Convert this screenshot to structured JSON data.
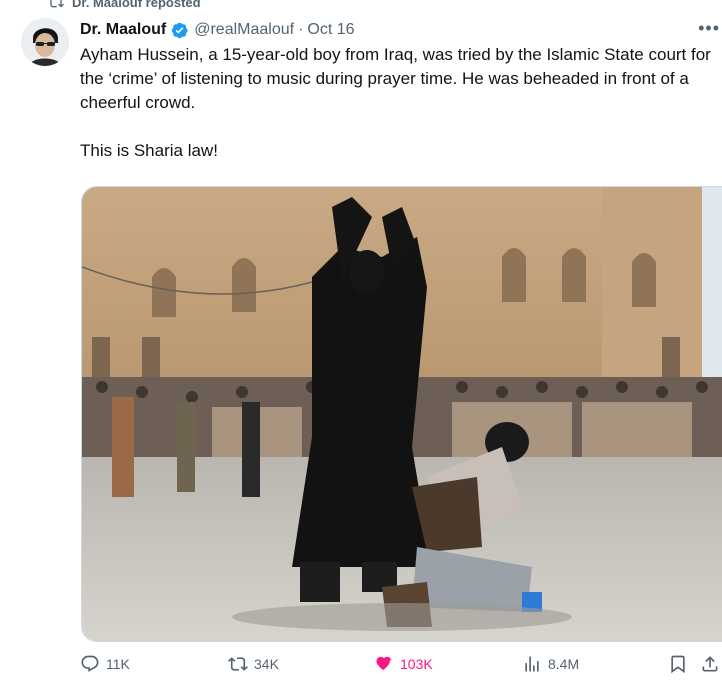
{
  "repost": {
    "label": "Dr. Maalouf reposted",
    "icon": "repost-icon"
  },
  "author": {
    "name": "Dr. Maalouf",
    "verified": true,
    "handle": "@realMaalouf",
    "separator": "·",
    "date": "Oct 16"
  },
  "more_icon": "more-icon",
  "tweet": {
    "text": "Ayham Hussein, a 15-year-old boy from Iraq, was tried by the Islamic State court for the ‘crime’ of listening to music during prayer time. He was beheaded in front of a cheerful crowd.\n\nThis is Sharia law!"
  },
  "actions": {
    "replies": "11K",
    "reposts": "34K",
    "likes": "103K",
    "views": "8.4M"
  },
  "colors": {
    "text": "#0f1419",
    "secondary": "#536471",
    "verified": "#1d9bf0",
    "like": "#f91880",
    "border": "#cfd9de"
  }
}
